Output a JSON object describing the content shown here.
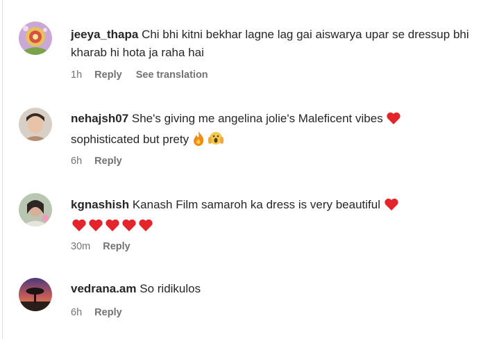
{
  "comments": [
    {
      "username": "jeeya_thapa",
      "text": "Chi bhi kitni bekhar lagne lag gai aiswarya upar se dressup bhi kharab hi hota ja raha hai",
      "time": "1h",
      "reply_label": "Reply",
      "translation_label": "See translation"
    },
    {
      "username": "nehajsh07",
      "text_line1": "She's giving me angelina jolie's Maleficent vibes",
      "text_line2": "sophisticated but prety",
      "time": "6h",
      "reply_label": "Reply"
    },
    {
      "username": "kgnashish",
      "text": "Kanash Film samaroh ka dress is very beautiful",
      "time": "30m",
      "reply_label": "Reply"
    },
    {
      "username": "vedrana.am",
      "text": "So ridikulos",
      "time": "6h",
      "reply_label": "Reply"
    }
  ],
  "emoji": {
    "heart": "red-heart-emoji",
    "fire": "fire-emoji",
    "scream": "face-screaming-emoji"
  }
}
